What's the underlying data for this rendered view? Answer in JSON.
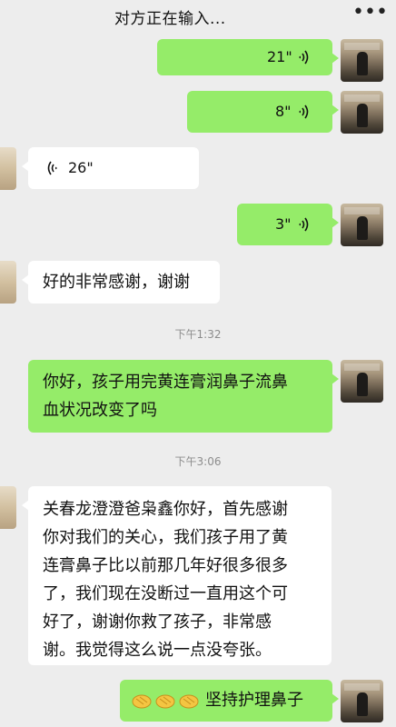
{
  "header": {
    "title": "对方正在输入...",
    "more_icon": "more-dots-icon",
    "more_glyph": "•••"
  },
  "messages": [
    {
      "side": "right",
      "type": "voice",
      "duration": "21\""
    },
    {
      "side": "right",
      "type": "voice",
      "duration": "8\""
    },
    {
      "side": "left",
      "type": "voice",
      "duration": "26\""
    },
    {
      "side": "right",
      "type": "voice",
      "duration": "3\""
    },
    {
      "side": "left",
      "type": "text",
      "text": "好的非常感谢，谢谢"
    },
    {
      "type": "time",
      "text": "下午1:32"
    },
    {
      "side": "right",
      "type": "text",
      "text": "你好，孩子用完黄连膏润鼻子流鼻\n血状况改变了吗"
    },
    {
      "type": "time",
      "text": "下午3:06"
    },
    {
      "side": "left",
      "type": "text",
      "text": "关春龙澄澄爸枭鑫你好，首先感谢\n你对我们的关心，我们孩子用了黄\n连膏鼻子比以前那几年好很多很多\n了，我们现在没断过一直用这个可\n好了，谢谢你救了孩子，非常感\n谢。我觉得这么说一点没夸张。"
    },
    {
      "side": "right",
      "type": "text",
      "emoji": "clapping-hands-emoji ×3",
      "text": "坚持护理鼻子"
    }
  ],
  "colors": {
    "background": "#ededed",
    "sent_bubble": "#95ec69",
    "received_bubble": "#ffffff",
    "timestamp": "#8d8d8d"
  }
}
